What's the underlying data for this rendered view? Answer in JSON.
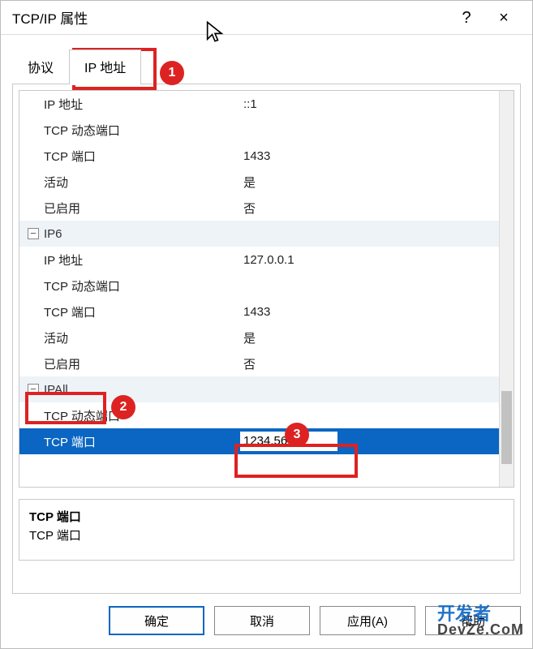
{
  "window": {
    "title": "TCP/IP 属性",
    "help": "?",
    "close": "×"
  },
  "tabs": {
    "protocol": "协议",
    "ip_address": "IP 地址"
  },
  "groups": [
    {
      "name": null,
      "rows": [
        {
          "label": "IP 地址",
          "value": "::1"
        },
        {
          "label": "TCP 动态端口",
          "value": ""
        },
        {
          "label": "TCP 端口",
          "value": "1433"
        },
        {
          "label": "活动",
          "value": "是"
        },
        {
          "label": "已启用",
          "value": "否"
        }
      ]
    },
    {
      "name": "IP6",
      "rows": [
        {
          "label": "IP 地址",
          "value": "127.0.0.1"
        },
        {
          "label": "TCP 动态端口",
          "value": ""
        },
        {
          "label": "TCP 端口",
          "value": "1433"
        },
        {
          "label": "活动",
          "value": "是"
        },
        {
          "label": "已启用",
          "value": "否"
        }
      ]
    },
    {
      "name": "IPAll",
      "rows": [
        {
          "label": "TCP 动态端口",
          "value": ""
        },
        {
          "label": "TCP 端口",
          "value": "1234,5678",
          "selected": true
        }
      ]
    }
  ],
  "description": {
    "title": "TCP 端口",
    "body": "TCP 端口"
  },
  "buttons": {
    "ok": "确定",
    "cancel": "取消",
    "apply": "应用(A)",
    "help": "帮助"
  },
  "annotations": {
    "c1": "1",
    "c2": "2",
    "c3": "3"
  },
  "watermark": {
    "line1": "开发者",
    "line2": "DevZe.CoM"
  },
  "expander_glyph": "−"
}
